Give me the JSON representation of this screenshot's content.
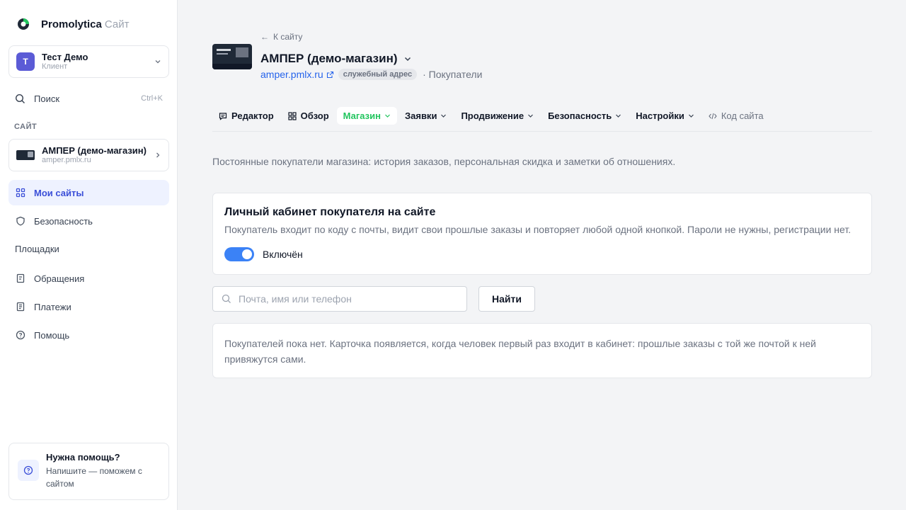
{
  "brand": {
    "name": "Promolytica",
    "suffix": "Сайт"
  },
  "account": {
    "initial": "Т",
    "name": "Тест Демо",
    "role": "Клиент"
  },
  "sidebar_search": {
    "label": "Поиск",
    "shortcut": "Ctrl+K"
  },
  "section_label": "САЙТ",
  "current_site": {
    "name": "АМПЕР (демо-магазин)",
    "domain": "amper.pmlx.ru"
  },
  "nav": {
    "my_sites": "Мои сайты",
    "security": "Безопасность",
    "platforms": "Площадки",
    "tickets": "Обращения",
    "payments": "Платежи",
    "help": "Помощь"
  },
  "help_card": {
    "title": "Нужна помощь?",
    "text": "Напишите — поможем с сайтом"
  },
  "header": {
    "back": "К сайту",
    "title": "АМПЕР (демо-магазин)",
    "url": "amper.pmlx.ru",
    "badge": "служебный адрес",
    "crumb": "· Покупатели"
  },
  "tabs": {
    "editor": "Редактор",
    "overview": "Обзор",
    "shop": "Магазин",
    "requests": "Заявки",
    "promotion": "Продвижение",
    "security": "Безопасность",
    "settings": "Настройки",
    "code": "Код сайта"
  },
  "intro": "Постоянные покупатели магазина: история заказов, персональная скидка и заметки об отношениях.",
  "panel": {
    "title": "Личный кабинет покупателя на сайте",
    "desc": "Покупатель входит по коду с почты, видит свои прошлые заказы и повторяет любой одной кнопкой. Пароли не нужны, регистрации нет.",
    "toggle_label": "Включён",
    "toggle_on": true
  },
  "search": {
    "placeholder": "Почта, имя или телефон",
    "value": "",
    "button": "Найти"
  },
  "empty_text": "Покупателей пока нет. Карточка появляется, когда человек первый раз входит в кабинет: прошлые заказы с той же почтой к ней привяжутся сами.",
  "colors": {
    "accent": "#3b4fd8",
    "active_tab": "#22c55e",
    "link": "#2563eb",
    "toggle": "#3b82f6"
  }
}
